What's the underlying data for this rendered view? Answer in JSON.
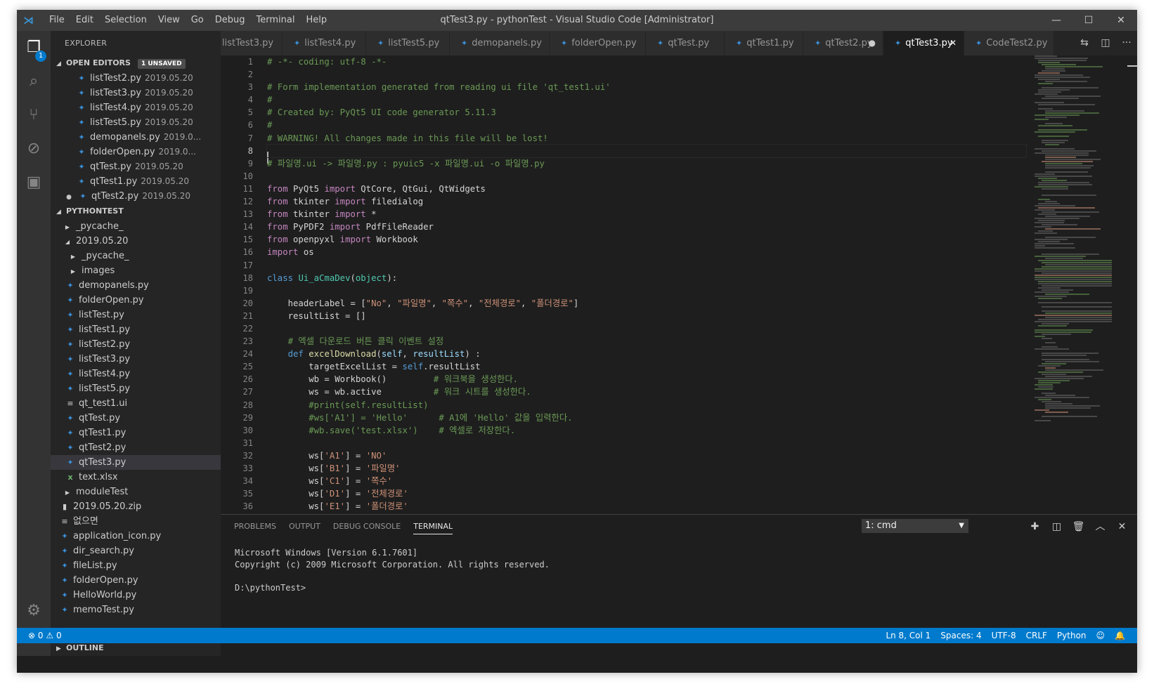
{
  "title_bar": {
    "menus": [
      "File",
      "Edit",
      "Selection",
      "View",
      "Go",
      "Debug",
      "Terminal",
      "Help"
    ],
    "window_title": "qtTest3.py - pythonTest - Visual Studio Code [Administrator]"
  },
  "activity_bar": {
    "explorer_badge": "1"
  },
  "sidebar": {
    "title": "EXPLORER",
    "open_editors": {
      "label": "OPEN EDITORS",
      "unsaved": "1 UNSAVED",
      "items": [
        {
          "name": "listTest2.py",
          "meta": "2019.05.20"
        },
        {
          "name": "listTest3.py",
          "meta": "2019.05.20"
        },
        {
          "name": "listTest4.py",
          "meta": "2019.05.20"
        },
        {
          "name": "listTest5.py",
          "meta": "2019.05.20"
        },
        {
          "name": "demopanels.py",
          "meta": "2019.0..."
        },
        {
          "name": "folderOpen.py",
          "meta": "2019.0..."
        },
        {
          "name": "qtTest.py",
          "meta": "2019.05.20"
        },
        {
          "name": "qtTest1.py",
          "meta": "2019.05.20"
        },
        {
          "name": "qtTest2.py",
          "meta": "2019.05.20"
        }
      ]
    },
    "project": {
      "label": "PYTHONTEST",
      "items": [
        {
          "name": "_pycache_"
        },
        {
          "name": "2019.05.20"
        },
        {
          "name": "_pycache_"
        },
        {
          "name": "images"
        },
        {
          "name": "demopanels.py"
        },
        {
          "name": "folderOpen.py"
        },
        {
          "name": "listTest.py"
        },
        {
          "name": "listTest1.py"
        },
        {
          "name": "listTest2.py"
        },
        {
          "name": "listTest3.py"
        },
        {
          "name": "listTest4.py"
        },
        {
          "name": "listTest5.py"
        },
        {
          "name": "qt_test1.ui"
        },
        {
          "name": "qtTest.py"
        },
        {
          "name": "qtTest1.py"
        },
        {
          "name": "qtTest2.py"
        },
        {
          "name": "qtTest3.py"
        },
        {
          "name": "text.xlsx"
        },
        {
          "name": "moduleTest"
        },
        {
          "name": "2019.05.20.zip"
        },
        {
          "name": "없으면"
        },
        {
          "name": "application_icon.py"
        },
        {
          "name": "dir_search.py"
        },
        {
          "name": "fileList.py"
        },
        {
          "name": "folderOpen.py"
        },
        {
          "name": "HelloWorld.py"
        },
        {
          "name": "memoTest.py"
        }
      ]
    },
    "outline_label": "OUTLINE"
  },
  "tabs": [
    {
      "label": "listTest3.py"
    },
    {
      "label": "listTest4.py"
    },
    {
      "label": "listTest5.py"
    },
    {
      "label": "demopanels.py"
    },
    {
      "label": "folderOpen.py"
    },
    {
      "label": "qtTest.py"
    },
    {
      "label": "qtTest1.py"
    },
    {
      "label": "qtTest2.py",
      "state": "●"
    },
    {
      "label": "qtTest3.py",
      "state": "✕"
    },
    {
      "label": "CodeTest2.py"
    }
  ],
  "editor": {
    "line_numbers": [
      "1",
      "2",
      "3",
      "4",
      "5",
      "6",
      "7",
      "8",
      "9",
      "10",
      "11",
      "12",
      "13",
      "14",
      "15",
      "16",
      "17",
      "18",
      "19",
      "20",
      "21",
      "22",
      "23",
      "24",
      "25",
      "26",
      "27",
      "28",
      "29",
      "30",
      "31",
      "32",
      "33",
      "34",
      "35",
      "36"
    ],
    "current_line": "8"
  },
  "panel": {
    "tabs": [
      "PROBLEMS",
      "OUTPUT",
      "DEBUG CONSOLE",
      "TERMINAL"
    ],
    "terminal_select": "1: cmd",
    "terminal_lines": [
      "Microsoft Windows [Version 6.1.7601]",
      "Copyright (c) 2009 Microsoft Corporation. All rights reserved.",
      "",
      "D:\\pythonTest>"
    ]
  },
  "status_bar": {
    "errors": "0",
    "warnings": "0",
    "items": [
      "Ln 8, Col 1",
      "Spaces: 4",
      "UTF-8",
      "CRLF",
      "Python"
    ]
  }
}
